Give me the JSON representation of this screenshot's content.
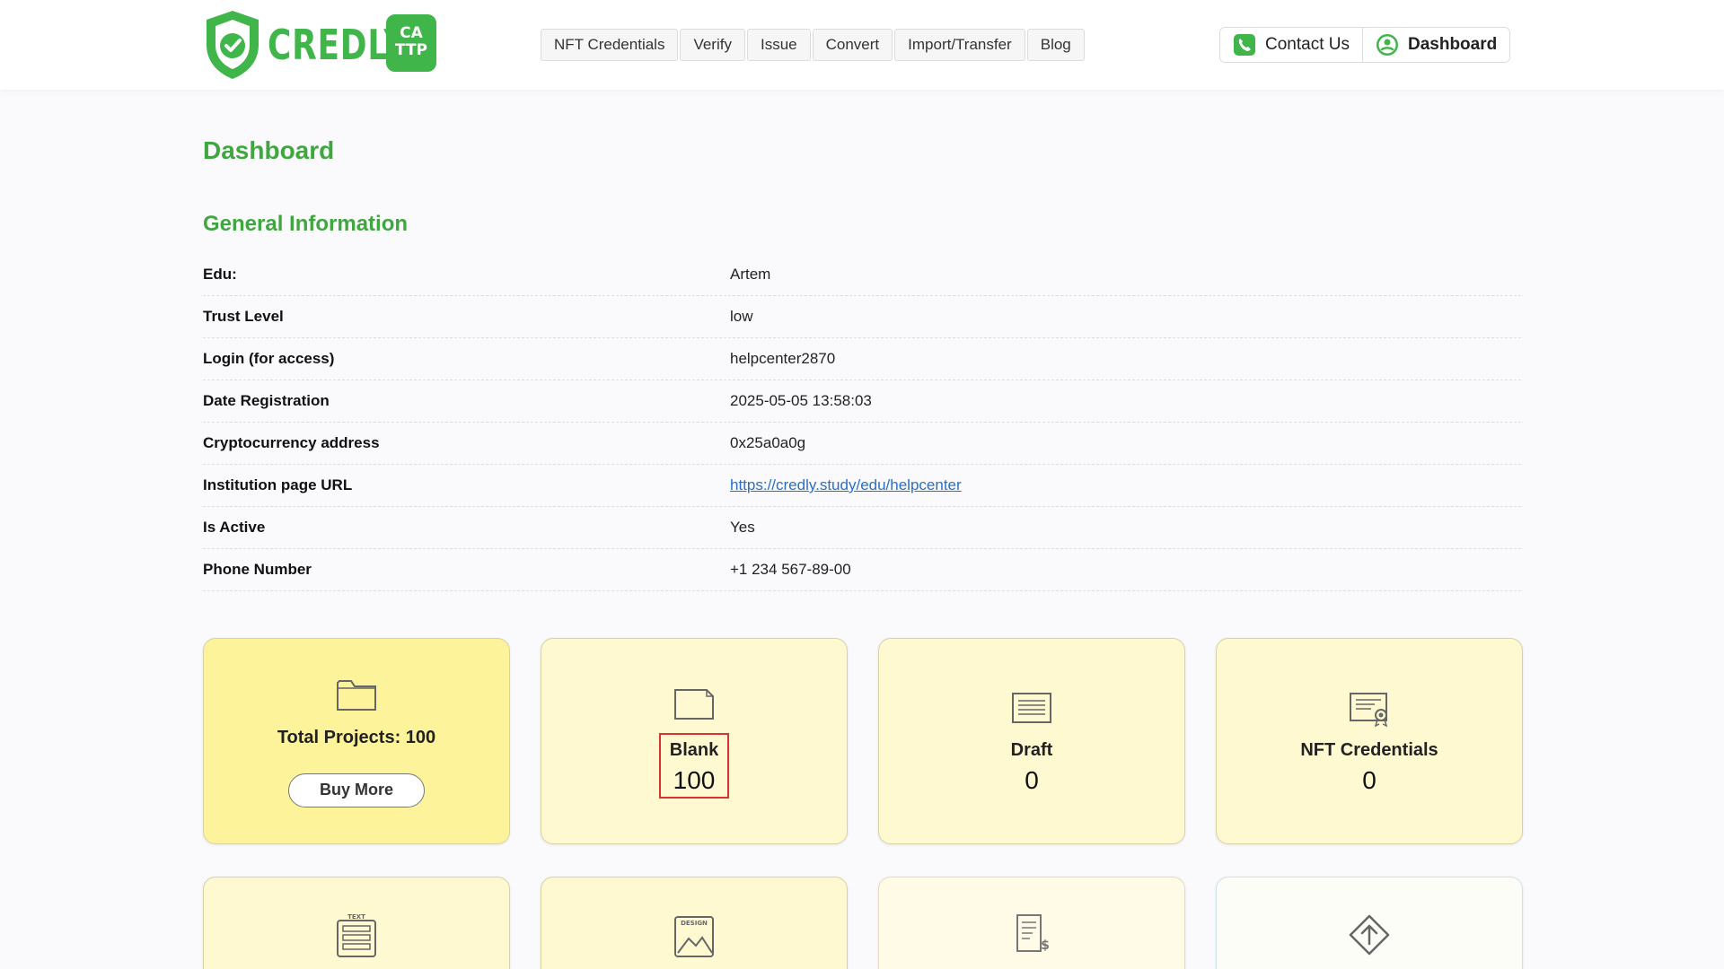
{
  "brand": {
    "name": "CREDLY",
    "badge_line1": "CA",
    "badge_line2": "TTP",
    "color": "#3fb54a"
  },
  "nav": {
    "items": [
      {
        "label": "NFT Credentials"
      },
      {
        "label": "Verify"
      },
      {
        "label": "Issue"
      },
      {
        "label": "Convert"
      },
      {
        "label": "Import/Transfer"
      },
      {
        "label": "Blog"
      }
    ]
  },
  "header_actions": {
    "contact": {
      "label": "Contact Us",
      "icon": "phone-icon"
    },
    "dashboard": {
      "label": "Dashboard",
      "icon": "user-icon"
    }
  },
  "page": {
    "title": "Dashboard",
    "section_title": "General Information"
  },
  "info": {
    "rows": [
      {
        "label": "Edu:",
        "value": "Artem"
      },
      {
        "label": "Trust Level",
        "value": "low"
      },
      {
        "label": "Login (for access)",
        "value": "helpcenter2870"
      },
      {
        "label": "Date Registration",
        "value": "2025-05-05 13:58:03"
      },
      {
        "label": "Cryptocurrency address",
        "value": "0x25a0a0g"
      },
      {
        "label": "Institution page URL",
        "value": "https://credly.study/edu/helpcenter",
        "is_link": true
      },
      {
        "label": "Is Active",
        "value": "Yes"
      },
      {
        "label": "Phone Number",
        "value": "+1 234 567-89-00"
      }
    ]
  },
  "cards": {
    "total": {
      "label": "Total Projects: 100",
      "button": "Buy More",
      "icon": "folder-icon"
    },
    "blank": {
      "label": "Blank",
      "count": "100",
      "icon": "blank-document-icon"
    },
    "draft": {
      "label": "Draft",
      "count": "0",
      "icon": "draft-document-icon"
    },
    "nft": {
      "label": "NFT Credentials",
      "count": "0",
      "icon": "certificate-icon"
    },
    "bottom": [
      {
        "icon": "text-template-icon",
        "icon_text": "TEXT"
      },
      {
        "icon": "design-template-icon",
        "icon_text": "DESIGN"
      },
      {
        "icon": "invoice-document-icon"
      },
      {
        "icon": "upload-diamond-icon"
      }
    ]
  },
  "colors": {
    "accent_green": "#3fa640",
    "card_bg": "#fff9d2",
    "card_highlight": "#fdf39a",
    "highlight_border": "#d93333",
    "link": "#2a6fc9"
  }
}
